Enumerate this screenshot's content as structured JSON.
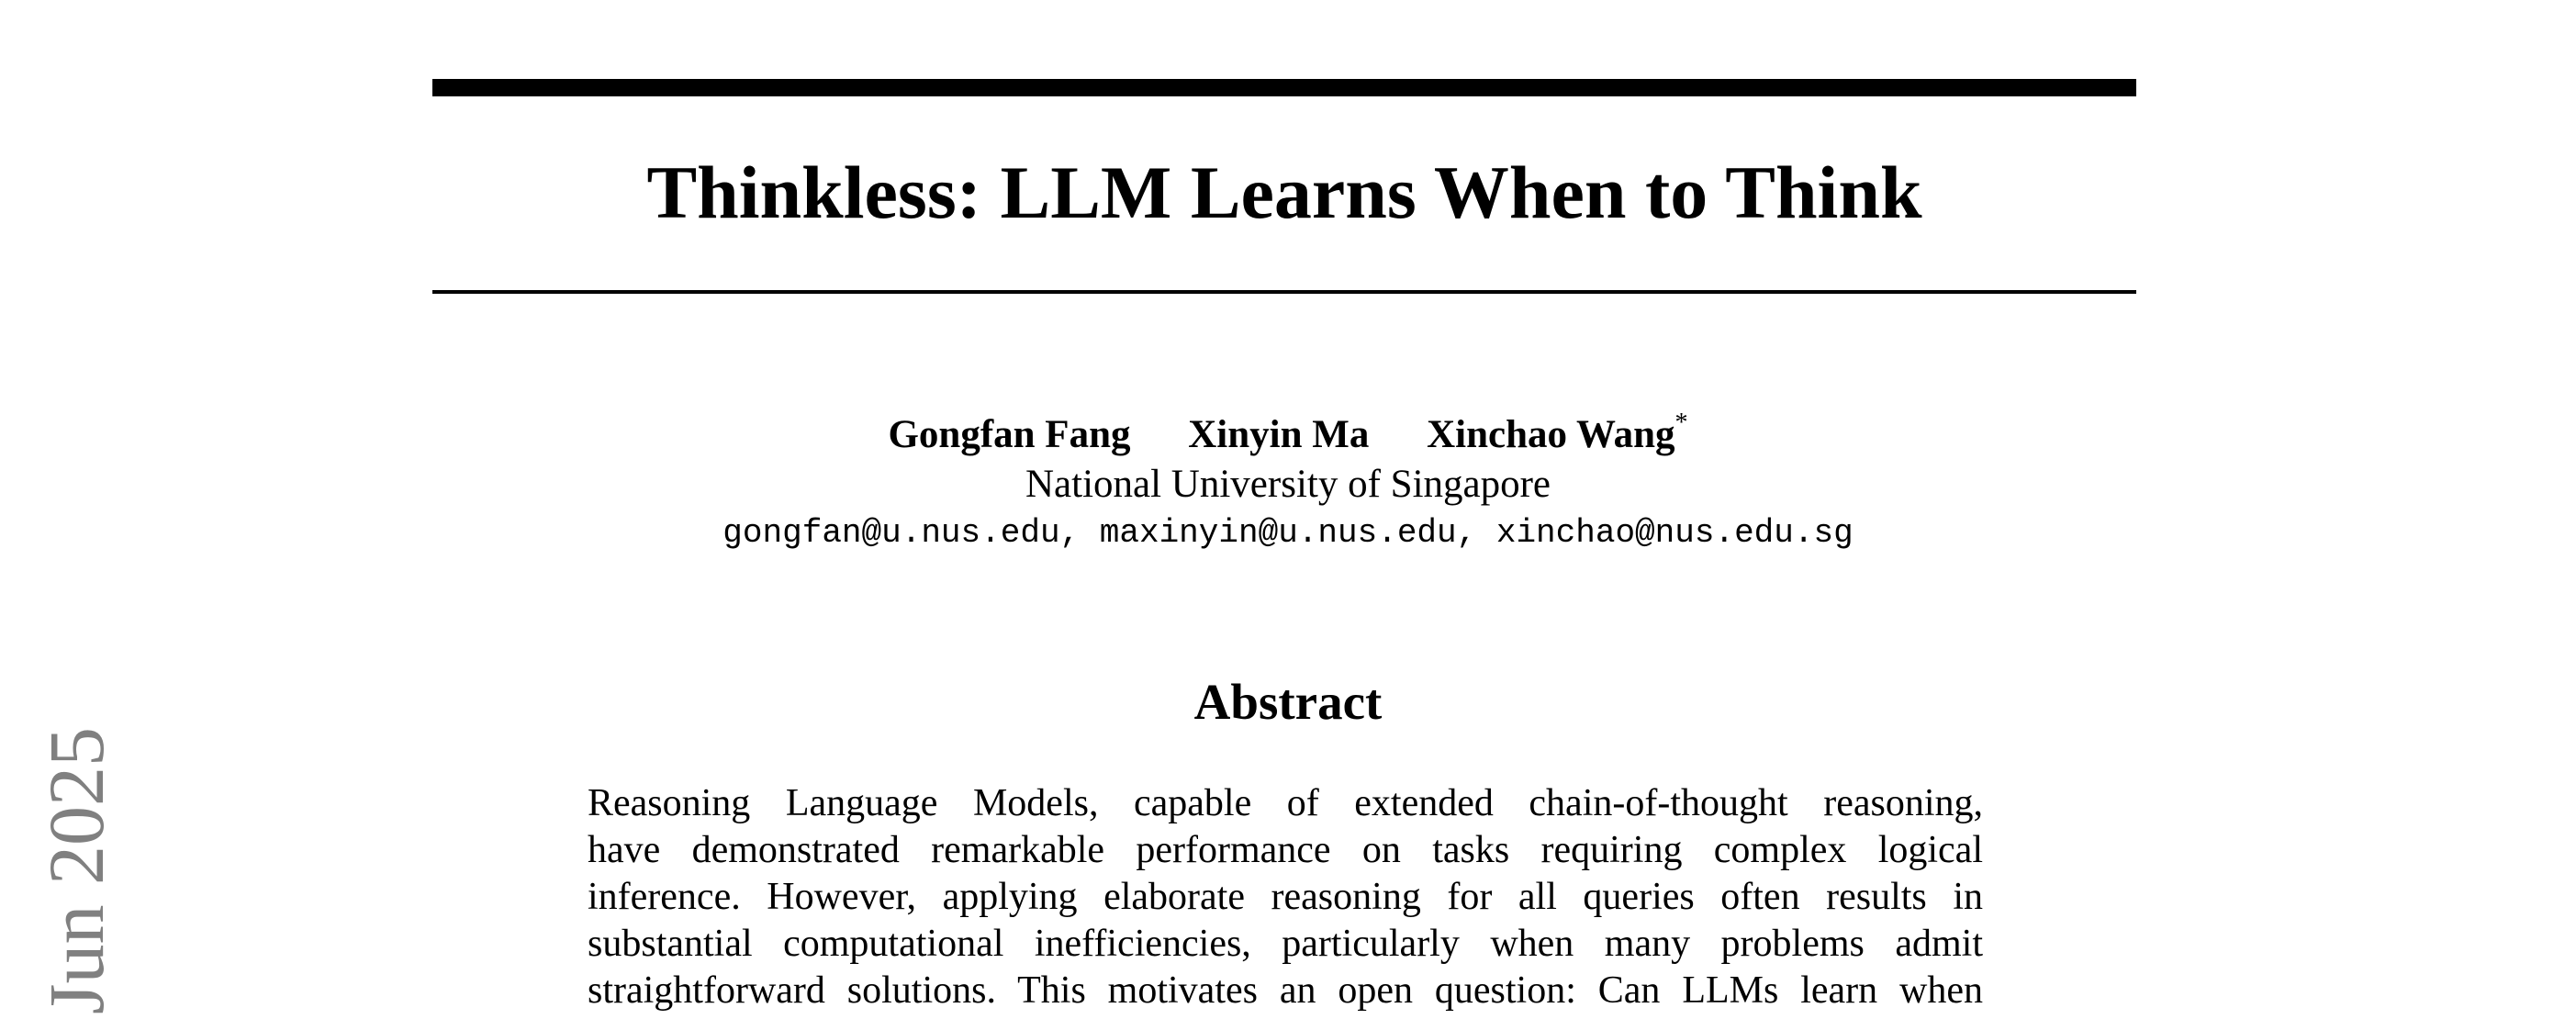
{
  "paper": {
    "title": "Thinkless: LLM Learns When to Think",
    "authors": [
      {
        "name": "Gongfan Fang",
        "mark": ""
      },
      {
        "name": "Xinyin Ma",
        "mark": ""
      },
      {
        "name": "Xinchao Wang",
        "mark": "*"
      }
    ],
    "affiliation": "National University of Singapore",
    "emails": "gongfan@u.nus.edu, maxinyin@u.nus.edu, xinchao@nus.edu.sg",
    "abstract_heading": "Abstract",
    "abstract_lines": [
      "Reasoning Language Models, capable of extended chain-of-thought reasoning,",
      "have demonstrated remarkable performance on tasks requiring complex logical",
      "inference. However, applying elaborate reasoning for all queries often results in",
      "substantial computational inefficiencies, particularly when many problems admit",
      "straightforward solutions. This motivates an open question: Can LLMs learn when"
    ]
  },
  "sidebar_stamp": {
    "text": "Jun 2025",
    "color": "#808080"
  }
}
